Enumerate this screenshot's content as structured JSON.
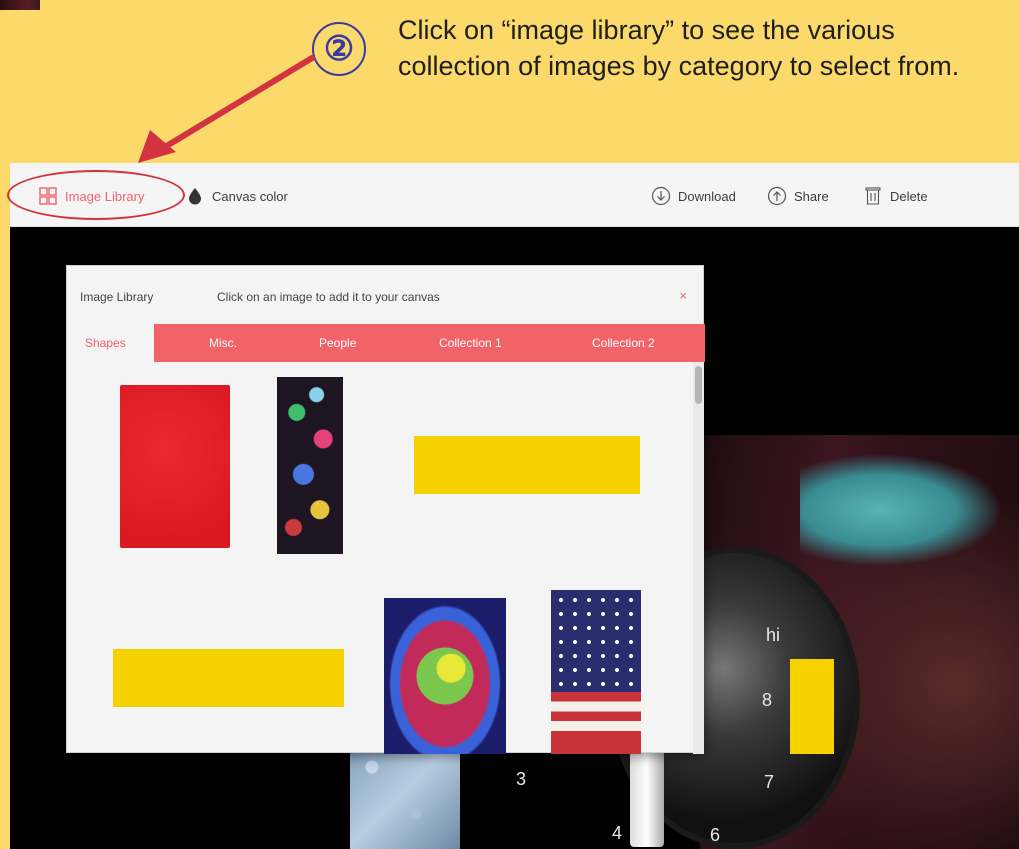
{
  "annotation": {
    "step_number": "②",
    "instruction": "Click on “image library” to see the various collection of images by category to select from.",
    "arrow_color": "#d33340"
  },
  "toolbar": {
    "image_library": "Image Library",
    "canvas_color": "Canvas color",
    "download": "Download",
    "share": "Share",
    "delete": "Delete",
    "icons": {
      "image_library": "grid-icon",
      "canvas_color": "drop-icon",
      "download": "download-icon",
      "share": "share-icon",
      "delete": "trash-icon"
    }
  },
  "modal": {
    "title": "Image Library",
    "subtitle": "Click on an image to add it to your canvas",
    "close": "×",
    "tabs": [
      {
        "label": "Shapes",
        "active": true
      },
      {
        "label": "Misc.",
        "active": false
      },
      {
        "label": "People",
        "active": false
      },
      {
        "label": "Collection 1",
        "active": false
      },
      {
        "label": "Collection 2",
        "active": false
      }
    ]
  },
  "canvas": {
    "dial_labels": [
      "hi",
      "8",
      "7",
      "6",
      "4",
      "3"
    ]
  },
  "colors": {
    "accent": "#f26367",
    "page_background": "#fbd96a",
    "canvas_background": "#000000"
  }
}
